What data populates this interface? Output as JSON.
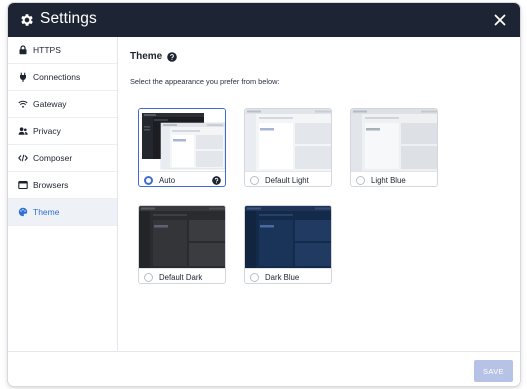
{
  "window": {
    "title": "Settings",
    "close_icon": "close-icon"
  },
  "sidebar": {
    "items": [
      {
        "label": "HTTPS",
        "icon": "lock-icon",
        "active": false
      },
      {
        "label": "Connections",
        "icon": "plug-icon",
        "active": false
      },
      {
        "label": "Gateway",
        "icon": "wifi-icon",
        "active": false
      },
      {
        "label": "Privacy",
        "icon": "users-icon",
        "active": false
      },
      {
        "label": "Composer",
        "icon": "code-icon",
        "active": false
      },
      {
        "label": "Browsers",
        "icon": "window-icon",
        "active": false
      },
      {
        "label": "Theme",
        "icon": "palette-icon",
        "active": true
      }
    ]
  },
  "main": {
    "heading": "Theme",
    "description": "Select the appearance you prefer from below:",
    "themes": [
      {
        "label": "Auto",
        "selected": true,
        "has_help": true,
        "variant": "auto"
      },
      {
        "label": "Default Light",
        "selected": false,
        "has_help": false,
        "variant": "light"
      },
      {
        "label": "Light Blue",
        "selected": false,
        "has_help": false,
        "variant": "lightblue"
      },
      {
        "label": "Default Dark",
        "selected": false,
        "has_help": false,
        "variant": "dark"
      },
      {
        "label": "Dark Blue",
        "selected": false,
        "has_help": false,
        "variant": "darkblue"
      }
    ]
  },
  "footer": {
    "save_label": "SAVE"
  },
  "colors": {
    "titlebar": "#1d2433",
    "accent": "#3f6bd6",
    "active_nav_text": "#2f6fd8",
    "save_button_disabled": "#b7c3e6"
  }
}
